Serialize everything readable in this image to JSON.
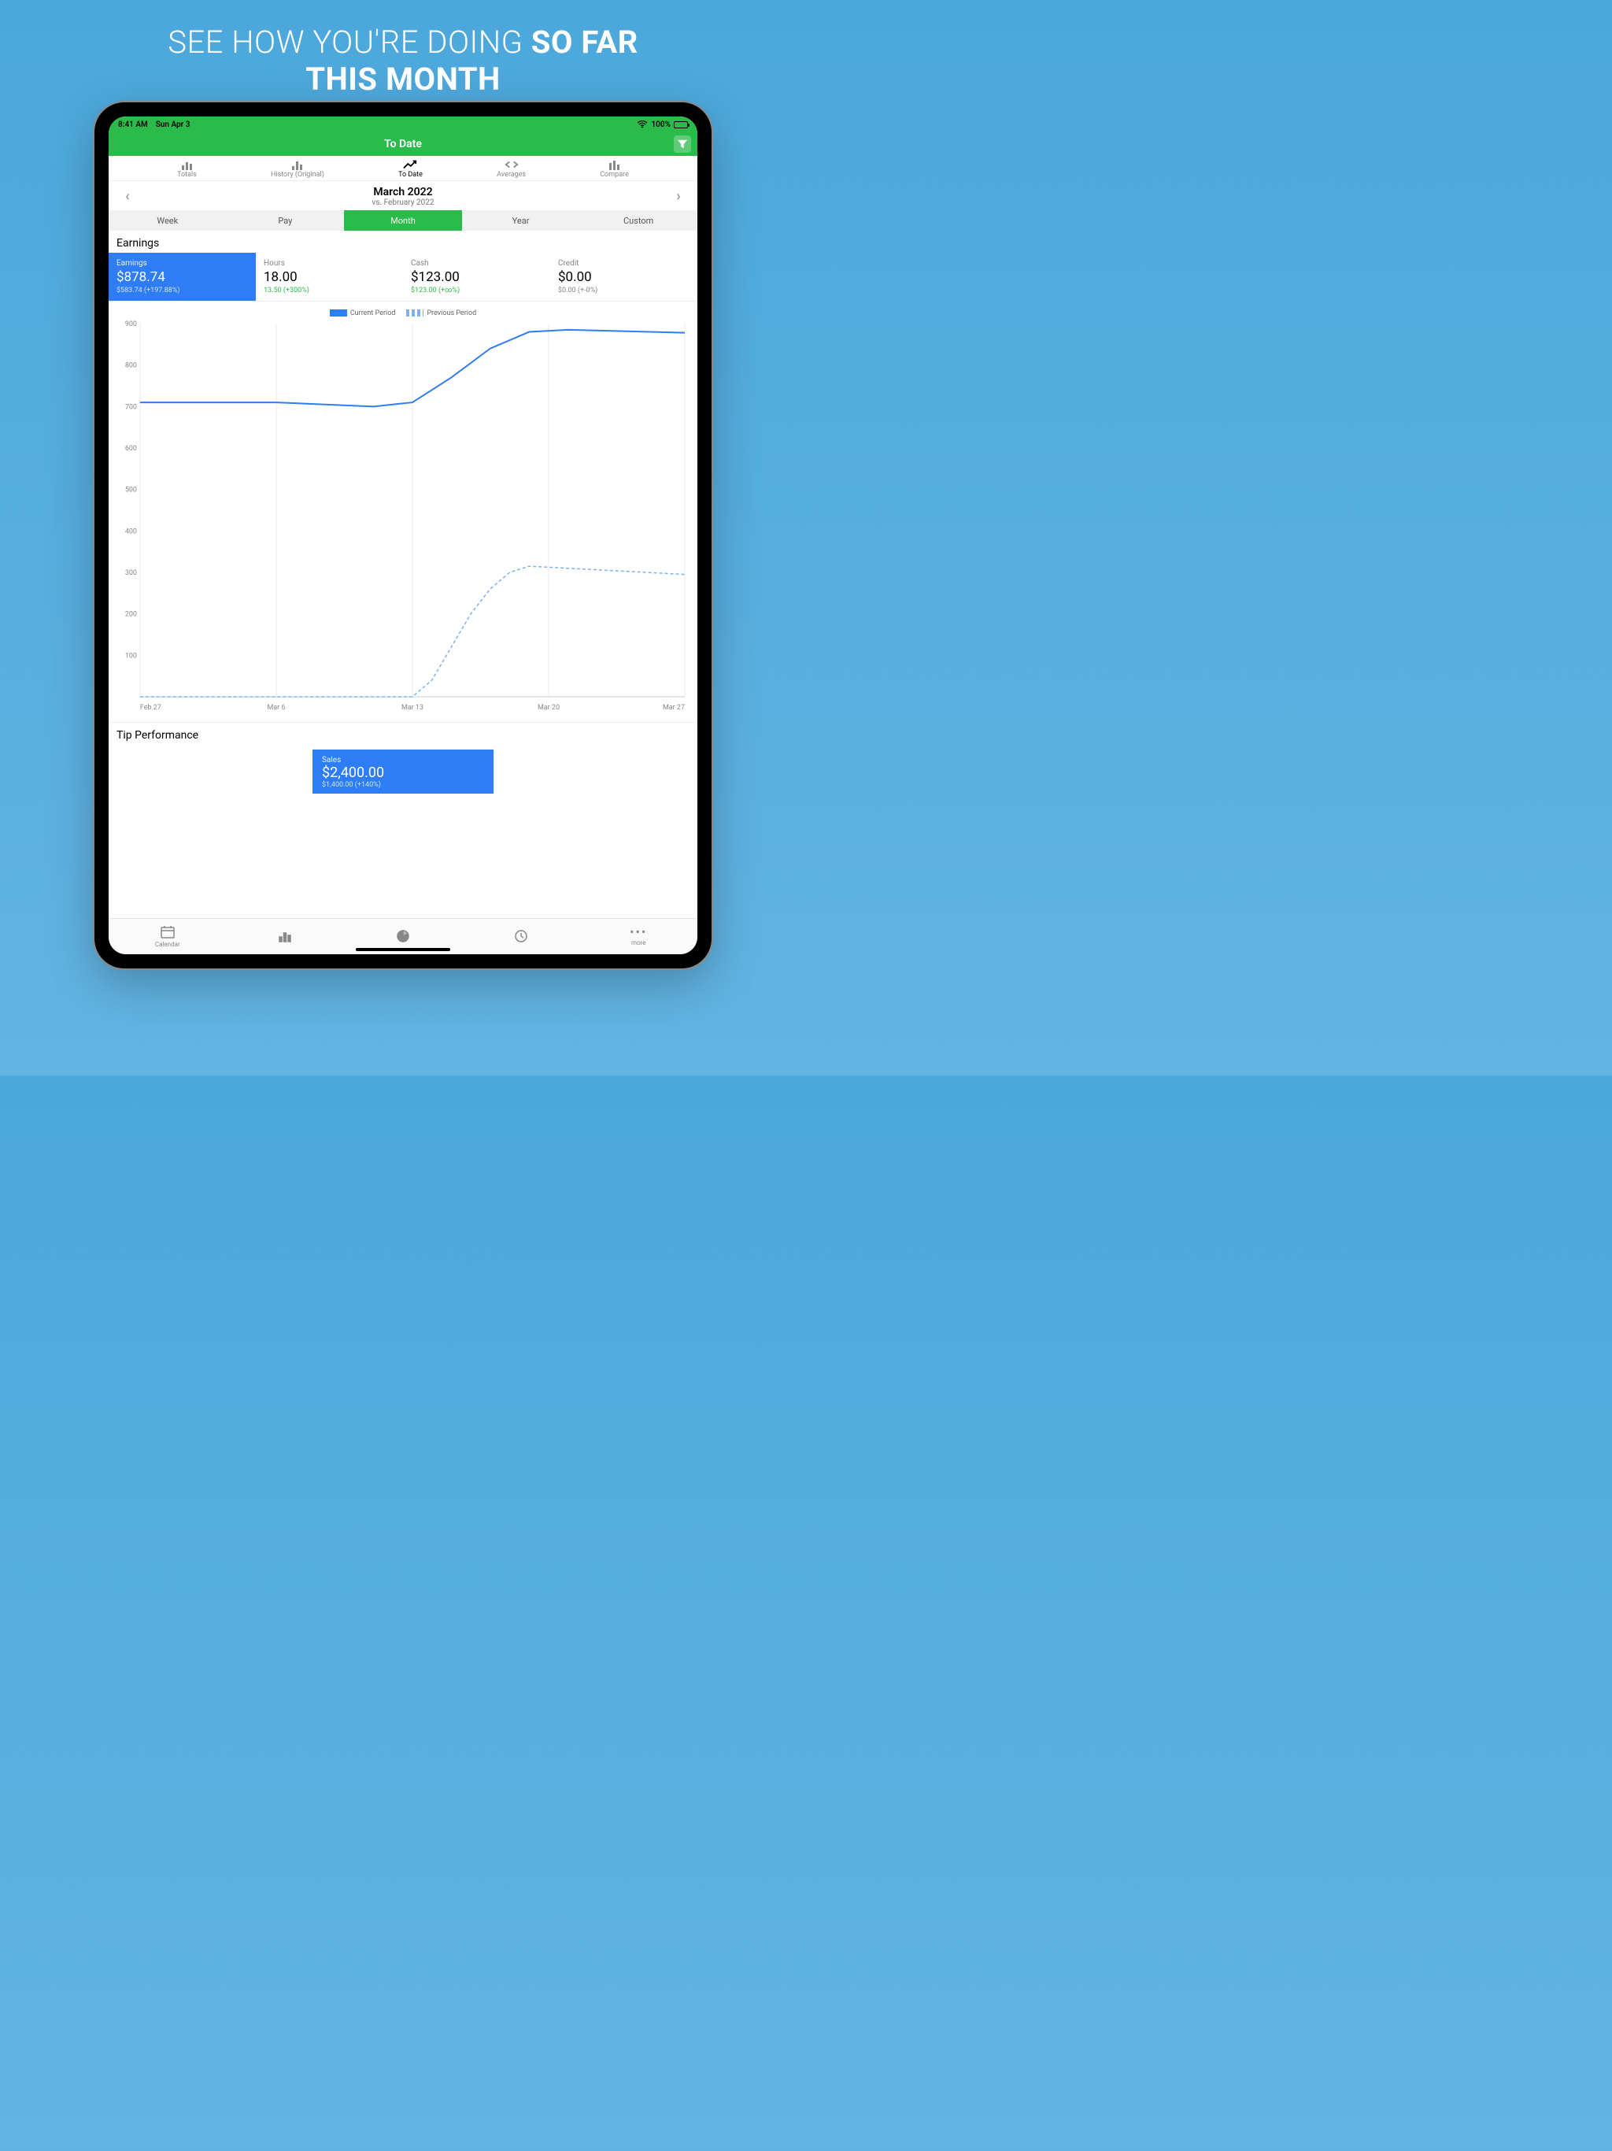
{
  "promo": {
    "line1": "SEE HOW YOU'RE DOING ",
    "bold1": "SO FAR",
    "line2_bold": "THIS MONTH"
  },
  "statusbar": {
    "time": "8:41 AM",
    "date": "Sun Apr 3",
    "battery_pct": "100%"
  },
  "header": {
    "title": "To Date"
  },
  "mode_tabs": {
    "items": [
      {
        "label": "Totals"
      },
      {
        "label": "History (Original)"
      },
      {
        "label": "To Date"
      },
      {
        "label": "Averages"
      },
      {
        "label": "Compare"
      }
    ],
    "active_index": 2
  },
  "period": {
    "main": "March 2022",
    "sub": "vs. February 2022"
  },
  "range_tabs": {
    "items": [
      "Week",
      "Pay",
      "Month",
      "Year",
      "Custom"
    ],
    "active_index": 2
  },
  "sections": {
    "earnings_title": "Earnings",
    "tip_title": "Tip Performance"
  },
  "metrics": [
    {
      "key": "earnings",
      "label": "Earnings",
      "value": "$878.74",
      "delta": "$583.74 (+197.88%)",
      "selected": true,
      "delta_class": ""
    },
    {
      "key": "hours",
      "label": "Hours",
      "value": "18.00",
      "delta": "13.50 (+300%)",
      "selected": false,
      "delta_class": "delta-green"
    },
    {
      "key": "cash",
      "label": "Cash",
      "value": "$123.00",
      "delta": "$123.00 (+∞%)",
      "selected": false,
      "delta_class": "delta-green"
    },
    {
      "key": "credit",
      "label": "Credit",
      "value": "$0.00",
      "delta": "$0.00 (+-0%)",
      "selected": false,
      "delta_class": "delta-gray"
    }
  ],
  "legend": {
    "current": "Current Period",
    "previous": "Previous Period"
  },
  "tip_card": {
    "label": "Sales",
    "value": "$2,400.00",
    "delta": "$1,400.00 (+140%)"
  },
  "bottom_tabs": [
    "Calendar",
    "",
    "",
    "",
    "more"
  ],
  "chart_data": {
    "type": "line",
    "xlabel": "",
    "ylabel": "",
    "ylim": [
      0,
      900
    ],
    "y_ticks": [
      100,
      200,
      300,
      400,
      500,
      600,
      700,
      800,
      900
    ],
    "x_ticks": [
      "Feb 27",
      "Mar 6",
      "Mar 13",
      "Mar 20",
      "Mar 27"
    ],
    "x_days": [
      0,
      7,
      14,
      21,
      28
    ],
    "series": [
      {
        "name": "Current Period",
        "style": "solid",
        "x": [
          0,
          7,
          12,
          14,
          16,
          18,
          20,
          22,
          28
        ],
        "y": [
          710,
          710,
          700,
          710,
          770,
          840,
          880,
          885,
          878
        ]
      },
      {
        "name": "Previous Period",
        "style": "dashed",
        "x": [
          0,
          14,
          15,
          16,
          17,
          18,
          19,
          20,
          22,
          28
        ],
        "y": [
          0,
          0,
          40,
          120,
          200,
          260,
          300,
          315,
          310,
          295
        ]
      }
    ]
  }
}
